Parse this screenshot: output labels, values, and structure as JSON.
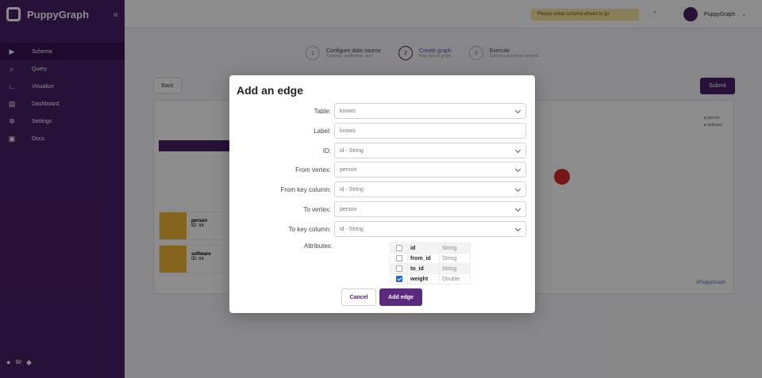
{
  "app": {
    "name": "PuppyGraph",
    "promo": "Please setup schema ahead to go",
    "user": "PuppyGraph",
    "nav": [
      {
        "label": "Schema",
        "icon": "play-icon"
      },
      {
        "label": "Query",
        "icon": "search-icon"
      },
      {
        "label": "Visualize",
        "icon": "chart-icon"
      },
      {
        "label": "Dashboard",
        "icon": "dashboard-icon"
      },
      {
        "label": "Settings",
        "icon": "gear-icon"
      },
      {
        "label": "Docs",
        "icon": "doc-icon"
      }
    ],
    "steps": [
      {
        "title": "Configure data source",
        "sub": "Catalogs, credentials, and"
      },
      {
        "title": "Create graph",
        "sub": "Map data to graph"
      },
      {
        "title": "Execute",
        "sub": "Submit & download schema"
      }
    ],
    "back": "Back",
    "submit": "Submit",
    "cards": [
      {
        "title": "person",
        "sub": "ID: int"
      },
      {
        "title": "software",
        "sub": "ID: int"
      }
    ],
    "legend": [
      "person",
      "software"
    ],
    "brand": "#PuppyGraph"
  },
  "modal": {
    "title": "Add an edge",
    "fields": {
      "table": {
        "label": "Table:",
        "value": "knows"
      },
      "edge_label": {
        "label": "Label:",
        "value": "knows"
      },
      "id": {
        "label": "ID:",
        "value": "id - String"
      },
      "from_vertex": {
        "label": "From vertex:",
        "value": "person"
      },
      "from_key": {
        "label": "From key column:",
        "value": "id - String"
      },
      "to_vertex": {
        "label": "To vertex:",
        "value": "person"
      },
      "to_key": {
        "label": "To key column:",
        "value": "id - String"
      }
    },
    "attributes_label": "Attributes:",
    "attributes": [
      {
        "name": "id",
        "type": "String",
        "checked": false
      },
      {
        "name": "from_id",
        "type": "String",
        "checked": false
      },
      {
        "name": "to_id",
        "type": "String",
        "checked": false
      },
      {
        "name": "weight",
        "type": "Double",
        "checked": true
      }
    ],
    "cancel": "Cancel",
    "add": "Add edge"
  }
}
